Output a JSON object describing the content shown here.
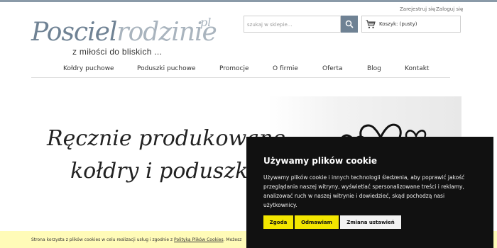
{
  "header": {
    "register_label": "Zarejestruj się",
    "login_label": "Zaloguj się",
    "logo": {
      "main": "Posciel",
      "accent": "rodzinie",
      "suffix": "pl",
      "tagline": "z miłości do bliskich ..."
    },
    "search": {
      "placeholder": "szukaj w sklepie..."
    },
    "cart": {
      "label": "Koszyk: (pusty)"
    }
  },
  "nav": {
    "items": [
      {
        "label": "Kołdry puchowe"
      },
      {
        "label": "Poduszki puchowe"
      },
      {
        "label": "Promocje"
      },
      {
        "label": "O firmie"
      },
      {
        "label": "Oferta"
      },
      {
        "label": "Blog"
      },
      {
        "label": "Kontakt"
      }
    ]
  },
  "hero": {
    "line1": "Ręcznie produkowane",
    "line2": "kołdry i poduszki"
  },
  "cookie_bar": {
    "text_before": "Strona korzysta z plików cookies w celu realizacji usług i zgodnie z ",
    "link": "Polityką Plików Cookies",
    "text_after": ". Możesz"
  },
  "cookie_modal": {
    "title": "Używamy plików cookie",
    "body": "Używamy plików cookie i innych technologii śledzenia, aby poprawić jakość przeglądania naszej witryny, wyświetlać spersonalizowane treści i reklamy, analizować ruch w naszej witrynie i dowiedzieć, skąd pochodzą nasi użytkownicy.",
    "accept_label": "Zgoda",
    "reject_label": "Odmawiam",
    "settings_label": "Zmiana ustawień"
  },
  "colors": {
    "brand": "#6f8294",
    "accent_yellow": "#f3e600",
    "modal_bg": "#111111",
    "consent_bar_bg": "#fffbb8"
  },
  "icons": [
    "search-icon",
    "cart-icon",
    "hearts-decoration"
  ]
}
